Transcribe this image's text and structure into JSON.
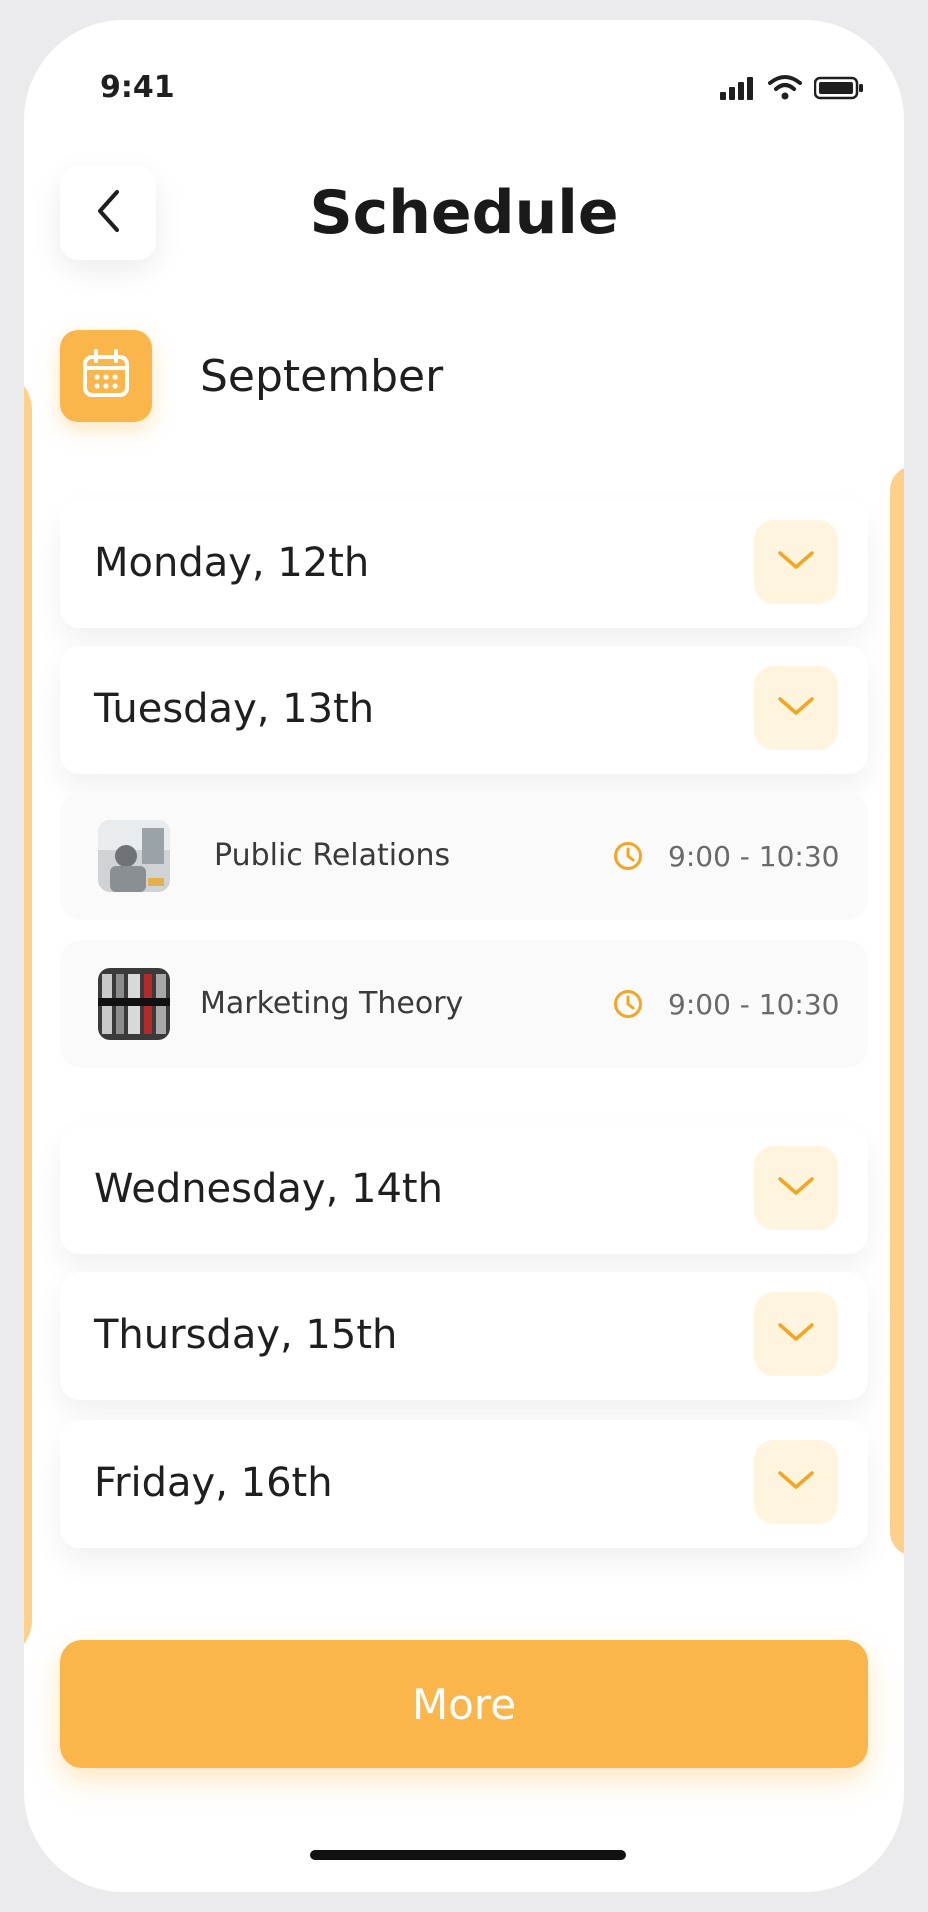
{
  "status": {
    "time": "9:41"
  },
  "header": {
    "title": "Schedule"
  },
  "month": {
    "label": "September"
  },
  "days": [
    {
      "label": "Monday, 12th"
    },
    {
      "label": "Tuesday, 13th"
    },
    {
      "label": "Wednesday, 14th"
    },
    {
      "label": "Thursday, 15th"
    },
    {
      "label": "Friday, 16th"
    }
  ],
  "classes": [
    {
      "title": "Public Relations",
      "time": "9:00 - 10:30"
    },
    {
      "title": "Marketing Theory",
      "time": "9:00 - 10:30"
    }
  ],
  "more_label": "More",
  "colors": {
    "accent": "#fab64a",
    "accent_light": "#fff4dd",
    "deco": "#fed08a"
  },
  "icons": [
    "back-icon",
    "calendar-icon",
    "chevron-down-icon",
    "clock-icon",
    "signal-icon",
    "wifi-icon",
    "battery-icon"
  ]
}
